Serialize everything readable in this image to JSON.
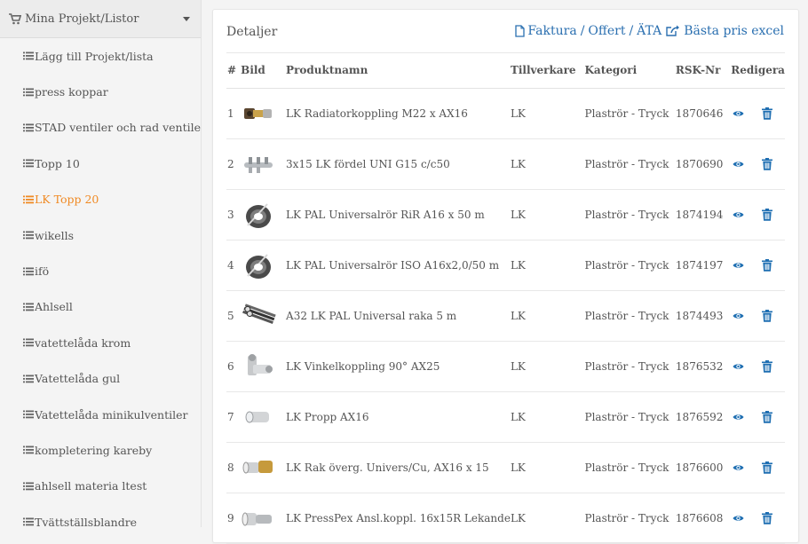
{
  "sidebar": {
    "header": "Mina Projekt/Listor",
    "items": [
      {
        "label": "Lägg till Projekt/lista",
        "active": false
      },
      {
        "label": "press koppar",
        "active": false
      },
      {
        "label": "STAD ventiler och rad ventiler",
        "active": false
      },
      {
        "label": "Topp 10",
        "active": false
      },
      {
        "label": "LK Topp 20",
        "active": true
      },
      {
        "label": "wikells",
        "active": false
      },
      {
        "label": "ifö",
        "active": false
      },
      {
        "label": "Ahlsell",
        "active": false
      },
      {
        "label": "vatettelåda krom",
        "active": false
      },
      {
        "label": "Vatettelåda gul",
        "active": false
      },
      {
        "label": "Vatettelåda minikulventiler",
        "active": false
      },
      {
        "label": "kompletering kareby",
        "active": false
      },
      {
        "label": "ahlsell materia ltest",
        "active": false
      },
      {
        "label": "Tvättställsblandre",
        "active": false
      }
    ]
  },
  "panel": {
    "title": "Detaljer",
    "links": {
      "faktura": "Faktura",
      "offert": "Offert",
      "ata": "ÄTA",
      "sep": "/",
      "basta": "Bästa pris excel"
    },
    "columns": {
      "num": "#",
      "img": "Bild",
      "name": "Produktnamn",
      "mfr": "Tillverkare",
      "cat": "Kategori",
      "rsk": "RSK-Nr",
      "edit": "Redigera"
    },
    "rows": [
      {
        "num": "1",
        "img": "radiator-coupling",
        "name": "LK Radiatorkoppling M22 x AX16",
        "mfr": "LK",
        "cat": "Plaströr - Tryck",
        "rsk": "1870646"
      },
      {
        "num": "2",
        "img": "manifold",
        "name": "3x15 LK fördel UNI G15 c/c50",
        "mfr": "LK",
        "cat": "Plaströr - Tryck",
        "rsk": "1870690"
      },
      {
        "num": "3",
        "img": "pipe-coil",
        "name": "LK PAL Universalrör RiR A16 x 50 m",
        "mfr": "LK",
        "cat": "Plaströr - Tryck",
        "rsk": "1874194"
      },
      {
        "num": "4",
        "img": "pipe-coil",
        "name": "LK PAL Universalrör ISO A16x2,0/50 m",
        "mfr": "LK",
        "cat": "Plaströr - Tryck",
        "rsk": "1874197"
      },
      {
        "num": "5",
        "img": "pipe-bundle",
        "name": "A32 LK PAL Universal raka 5 m",
        "mfr": "LK",
        "cat": "Plaströr - Tryck",
        "rsk": "1874493"
      },
      {
        "num": "6",
        "img": "elbow",
        "name": "LK Vinkelkoppling 90° AX25",
        "mfr": "LK",
        "cat": "Plaströr - Tryck",
        "rsk": "1876532"
      },
      {
        "num": "7",
        "img": "plug",
        "name": "LK Propp AX16",
        "mfr": "LK",
        "cat": "Plaströr - Tryck",
        "rsk": "1876592"
      },
      {
        "num": "8",
        "img": "adapter",
        "name": "LK Rak överg. Univers/Cu, AX16 x 15",
        "mfr": "LK",
        "cat": "Plaströr - Tryck",
        "rsk": "1876600"
      },
      {
        "num": "9",
        "img": "connector",
        "name": "LK PressPex Ansl.koppl. 16x15R Lekande",
        "mfr": "LK",
        "cat": "Plaströr - Tryck",
        "rsk": "1876608"
      }
    ]
  },
  "icons": {
    "view": "eye-icon",
    "delete": "trash-icon",
    "file": "file-icon",
    "share": "share-icon",
    "cart": "shopping-cart-icon",
    "list": "list-icon"
  },
  "colors": {
    "active": "#f08a24",
    "link": "#2a6fb0",
    "icon": "#1f6fb2"
  }
}
